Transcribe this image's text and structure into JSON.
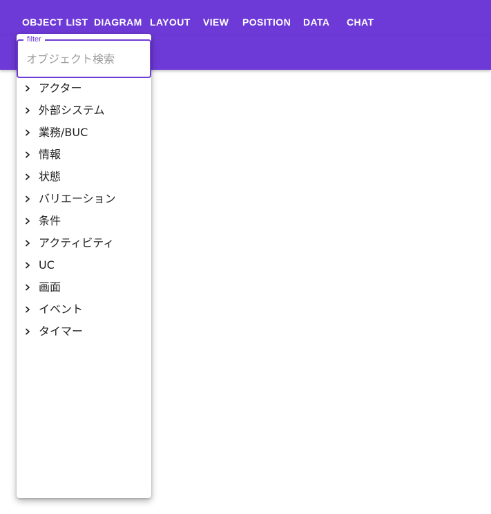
{
  "nav": {
    "tabs": [
      {
        "label": "OBJECT LIST"
      },
      {
        "label": "DIAGRAM"
      },
      {
        "label": "LAYOUT"
      },
      {
        "label": "VIEW"
      },
      {
        "label": "POSITION"
      },
      {
        "label": "DATA"
      },
      {
        "label": "CHAT"
      }
    ]
  },
  "filter": {
    "legend": "filter",
    "placeholder": "オブジェクト検索",
    "value": ""
  },
  "tree": {
    "items": [
      {
        "label": "アクター"
      },
      {
        "label": "外部システム"
      },
      {
        "label": "業務/BUC"
      },
      {
        "label": "情報"
      },
      {
        "label": "状態"
      },
      {
        "label": "バリエーション"
      },
      {
        "label": "条件"
      },
      {
        "label": "アクティビティ"
      },
      {
        "label": "UC"
      },
      {
        "label": "画面"
      },
      {
        "label": "イベント"
      },
      {
        "label": "タイマー"
      }
    ]
  },
  "colors": {
    "primary": "#6e3ad7",
    "text": "#212121",
    "placeholder": "#9e9e9e"
  },
  "icons": {
    "tree_toggle": "chevron-right-icon"
  }
}
